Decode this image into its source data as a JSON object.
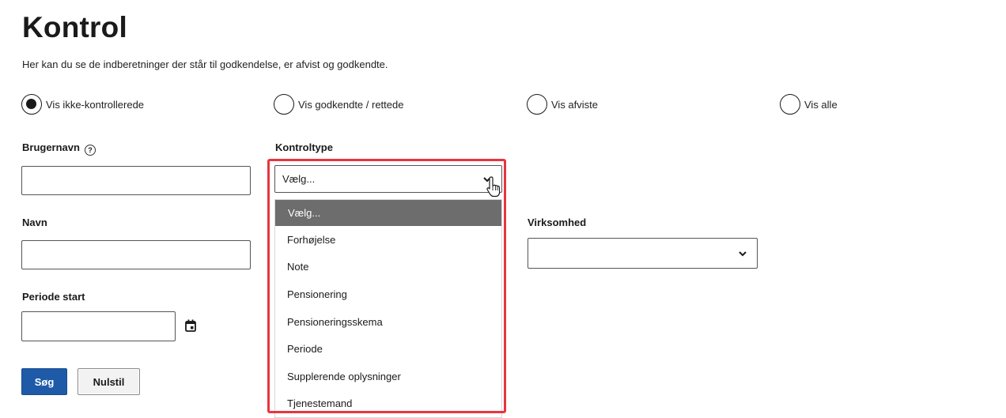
{
  "page": {
    "title": "Kontrol",
    "intro": "Her kan du se de indberetninger der står til godkendelse, er afvist og godkendte."
  },
  "filter_radios": [
    {
      "label": "Vis ikke-kontrollerede",
      "checked": true
    },
    {
      "label": "Vis godkendte / rettede",
      "checked": false
    },
    {
      "label": "Vis afviste",
      "checked": false
    },
    {
      "label": "Vis alle",
      "checked": false
    }
  ],
  "form": {
    "brugernavn_label": "Brugernavn",
    "brugernavn_value": "",
    "navn_label": "Navn",
    "navn_value": "",
    "periode_start_label": "Periode start",
    "periode_start_value": "",
    "kontroltype_label": "Kontroltype",
    "kontroltype_value": "Vælg...",
    "virksomhed_label": "Virksomhed",
    "virksomhed_value": ""
  },
  "kontroltype_options": [
    "Vælg...",
    "Forhøjelse",
    "Note",
    "Pensionering",
    "Pensioneringsskema",
    "Periode",
    "Supplerende oplysninger",
    "Tjenestemand"
  ],
  "kontroltype_selected_index": 0,
  "buttons": {
    "search": "Søg",
    "reset": "Nulstil"
  },
  "colors": {
    "primary_button": "#1e5aa8",
    "highlight_border": "#e8343f",
    "selected_option_bg": "#6d6d6d"
  }
}
